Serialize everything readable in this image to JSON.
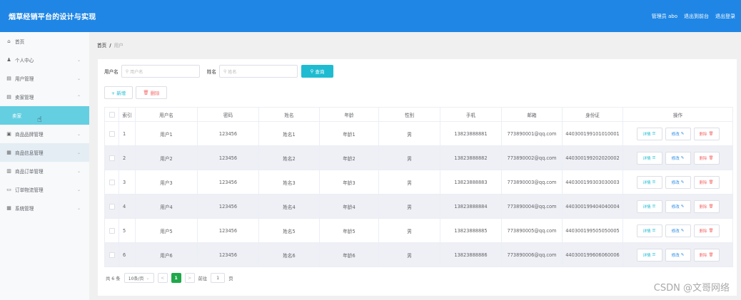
{
  "header": {
    "title": "烟草经销平台的设计与实现",
    "admin_label": "管理员 abo",
    "back_label": "退出到前台",
    "logout_label": "退出登录"
  },
  "sidebar": {
    "items": [
      {
        "label": "首页",
        "icon": "home-icon"
      },
      {
        "label": "个人中心",
        "icon": "user-icon"
      },
      {
        "label": "用户管理",
        "icon": "list-icon"
      },
      {
        "label": "卖家管理",
        "icon": "list-icon"
      },
      {
        "label": "卖家",
        "icon": ""
      },
      {
        "label": "商品品牌管理",
        "icon": "card-icon"
      },
      {
        "label": "商品信息管理",
        "icon": "doc-icon"
      },
      {
        "label": "商品订单管理",
        "icon": "barcode-icon"
      },
      {
        "label": "订单物流管理",
        "icon": "inbox-icon"
      },
      {
        "label": "系统管理",
        "icon": "grid-icon"
      }
    ]
  },
  "breadcrumb": {
    "home": "首页",
    "sep": "/",
    "current": "用户"
  },
  "search": {
    "username_label": "用户名",
    "username_placeholder": "用户名",
    "name_label": "姓名",
    "name_placeholder": "姓名",
    "query_button": "查询"
  },
  "actions": {
    "add": "+ 新增",
    "delete": "删除"
  },
  "table": {
    "headers": [
      "",
      "索引",
      "用户名",
      "密码",
      "姓名",
      "年龄",
      "性别",
      "手机",
      "邮箱",
      "身份证",
      "操作"
    ],
    "rows": [
      {
        "index": "1",
        "username": "用户1",
        "password": "123456",
        "name": "姓名1",
        "age": "年龄1",
        "gender": "男",
        "phone": "13823888881",
        "email": "773890001@qq.com",
        "idcard": "440300199101010001"
      },
      {
        "index": "2",
        "username": "用户2",
        "password": "123456",
        "name": "姓名2",
        "age": "年龄2",
        "gender": "男",
        "phone": "13823888882",
        "email": "773890002@qq.com",
        "idcard": "440300199202020002"
      },
      {
        "index": "3",
        "username": "用户3",
        "password": "123456",
        "name": "姓名3",
        "age": "年龄3",
        "gender": "男",
        "phone": "13823888883",
        "email": "773890003@qq.com",
        "idcard": "440300199303030003"
      },
      {
        "index": "4",
        "username": "用户4",
        "password": "123456",
        "name": "姓名4",
        "age": "年龄4",
        "gender": "男",
        "phone": "13823888884",
        "email": "773890004@qq.com",
        "idcard": "440300199404040004"
      },
      {
        "index": "5",
        "username": "用户5",
        "password": "123456",
        "name": "姓名5",
        "age": "年龄5",
        "gender": "男",
        "phone": "13823888885",
        "email": "773890005@qq.com",
        "idcard": "440300199505050005"
      },
      {
        "index": "6",
        "username": "用户6",
        "password": "123456",
        "name": "姓名6",
        "age": "年龄6",
        "gender": "男",
        "phone": "13823888886",
        "email": "773890006@qq.com",
        "idcard": "440300199606060006"
      }
    ],
    "op_detail": "详情",
    "op_edit": "修改",
    "op_delete": "删除"
  },
  "pager": {
    "total": "共 6 条",
    "page_size": "10条/页",
    "prev": "<",
    "current": "1",
    "next": ">",
    "goto_label": "前往",
    "goto_value": "1",
    "page_unit": "页"
  },
  "watermark": "CSDN @文哥网络",
  "colors": {
    "header": "#1f86e5",
    "accent": "#1fbcd1",
    "active_sub": "#64cfe1",
    "danger": "#f56c6c",
    "pager_current": "#1fa84a"
  }
}
